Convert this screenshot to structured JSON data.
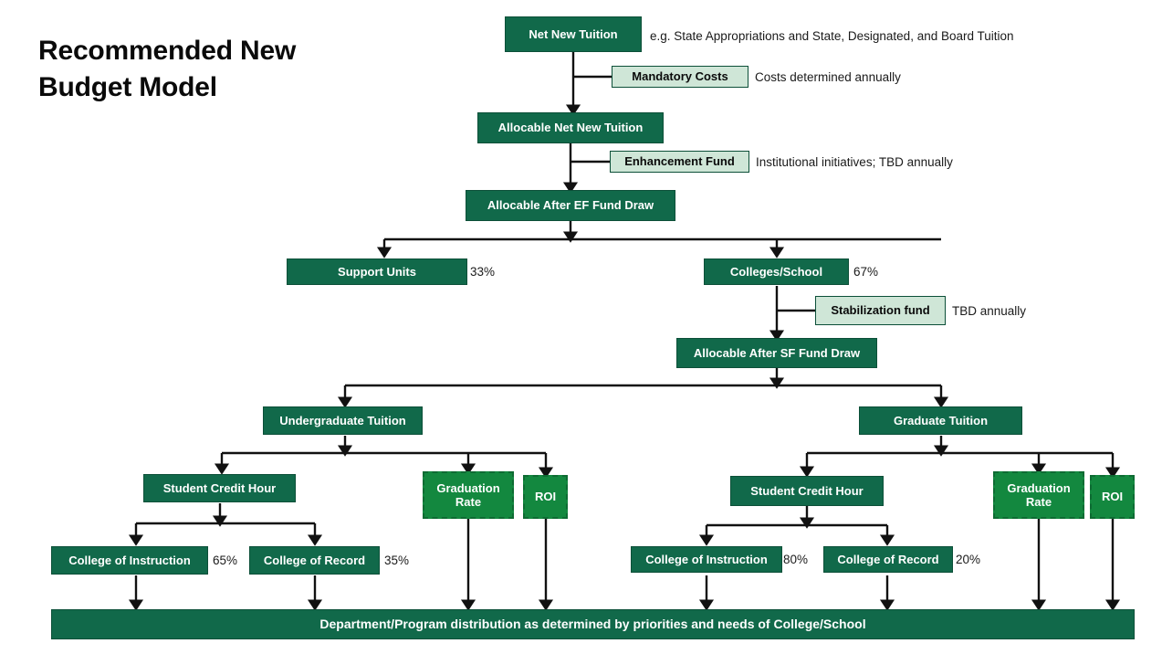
{
  "title": "Recommended New Budget Model",
  "colors": {
    "dark_green": "#11694a",
    "bright_green": "#13883f",
    "light_green": "#cfe6d7",
    "border": "#0c4f38",
    "text_on_dark": "#ffffff",
    "text_dark": "#1a1a1a"
  },
  "nodes": {
    "net_new_tuition": "Net New Tuition",
    "mandatory_costs": "Mandatory Costs",
    "allocable_net_new_tuition": "Allocable Net New Tuition",
    "enhancement_fund": "Enhancement Fund",
    "allocable_after_ef": "Allocable After EF Fund Draw",
    "support_units": "Support Units",
    "colleges_school": "Colleges/School",
    "stabilization_fund": "Stabilization fund",
    "allocable_after_sf": "Allocable After SF Fund Draw",
    "undergraduate_tuition": "Undergraduate Tuition",
    "graduate_tuition": "Graduate Tuition",
    "ug_student_credit_hour": "Student Credit Hour",
    "ug_graduation_rate": "Graduation Rate",
    "ug_roi": "ROI",
    "gr_student_credit_hour": "Student Credit Hour",
    "gr_graduation_rate": "Graduation Rate",
    "gr_roi": "ROI",
    "ug_college_of_instruction": "College of Instruction",
    "ug_college_of_record": "College of Record",
    "gr_college_of_instruction": "College of Instruction",
    "gr_college_of_record": "College of Record",
    "department_distribution": "Department/Program distribution as determined by priorities and needs of College/School"
  },
  "notes": {
    "net_new_tuition": "e.g. State Appropriations and State, Designated, and Board Tuition",
    "mandatory_costs": "Costs determined annually",
    "enhancement_fund": "Institutional initiatives; TBD annually",
    "stabilization_fund": "TBD annually"
  },
  "percentages": {
    "support_units": "33%",
    "colleges_school": "67%",
    "ug_college_of_instruction": "65%",
    "ug_college_of_record": "35%",
    "gr_college_of_instruction": "80%",
    "gr_college_of_record": "20%"
  }
}
